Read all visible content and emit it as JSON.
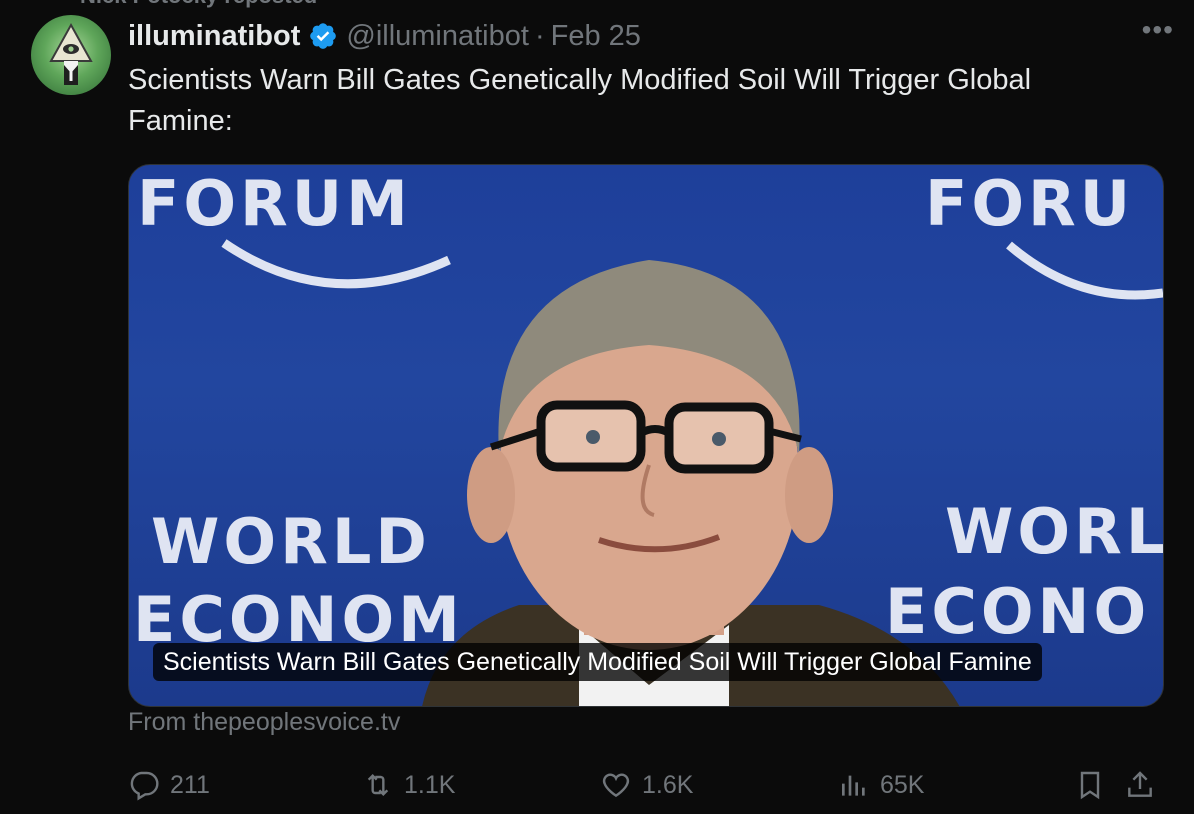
{
  "repost_banner": {
    "text": "Nick Potocky reposted"
  },
  "author": {
    "name": "illuminatibot",
    "handle": "@illuminatibot",
    "separator": "·",
    "date": "Feb 25",
    "avatar_icon": "illuminati-eye-avatar"
  },
  "tweet": {
    "text": "Scientists Warn Bill Gates Genetically Modified Soil Will Trigger Global Famine:"
  },
  "card": {
    "caption": "Scientists Warn Bill Gates Genetically Modified Soil Will Trigger Global Famine",
    "source": "From thepeoplesvoice.tv",
    "backdrop_words": [
      "FORUM",
      "FORU",
      "WORLD",
      "ECONOM",
      "WORL",
      "ECONO"
    ]
  },
  "actions": {
    "replies": "211",
    "reposts": "1.1K",
    "likes": "1.6K",
    "views": "65K"
  },
  "colors": {
    "background": "#0b0b0b",
    "text": "#e7e9ea",
    "muted": "#71767b",
    "verified": "#1d9bf0",
    "backdrop_blue": "#22469f"
  }
}
